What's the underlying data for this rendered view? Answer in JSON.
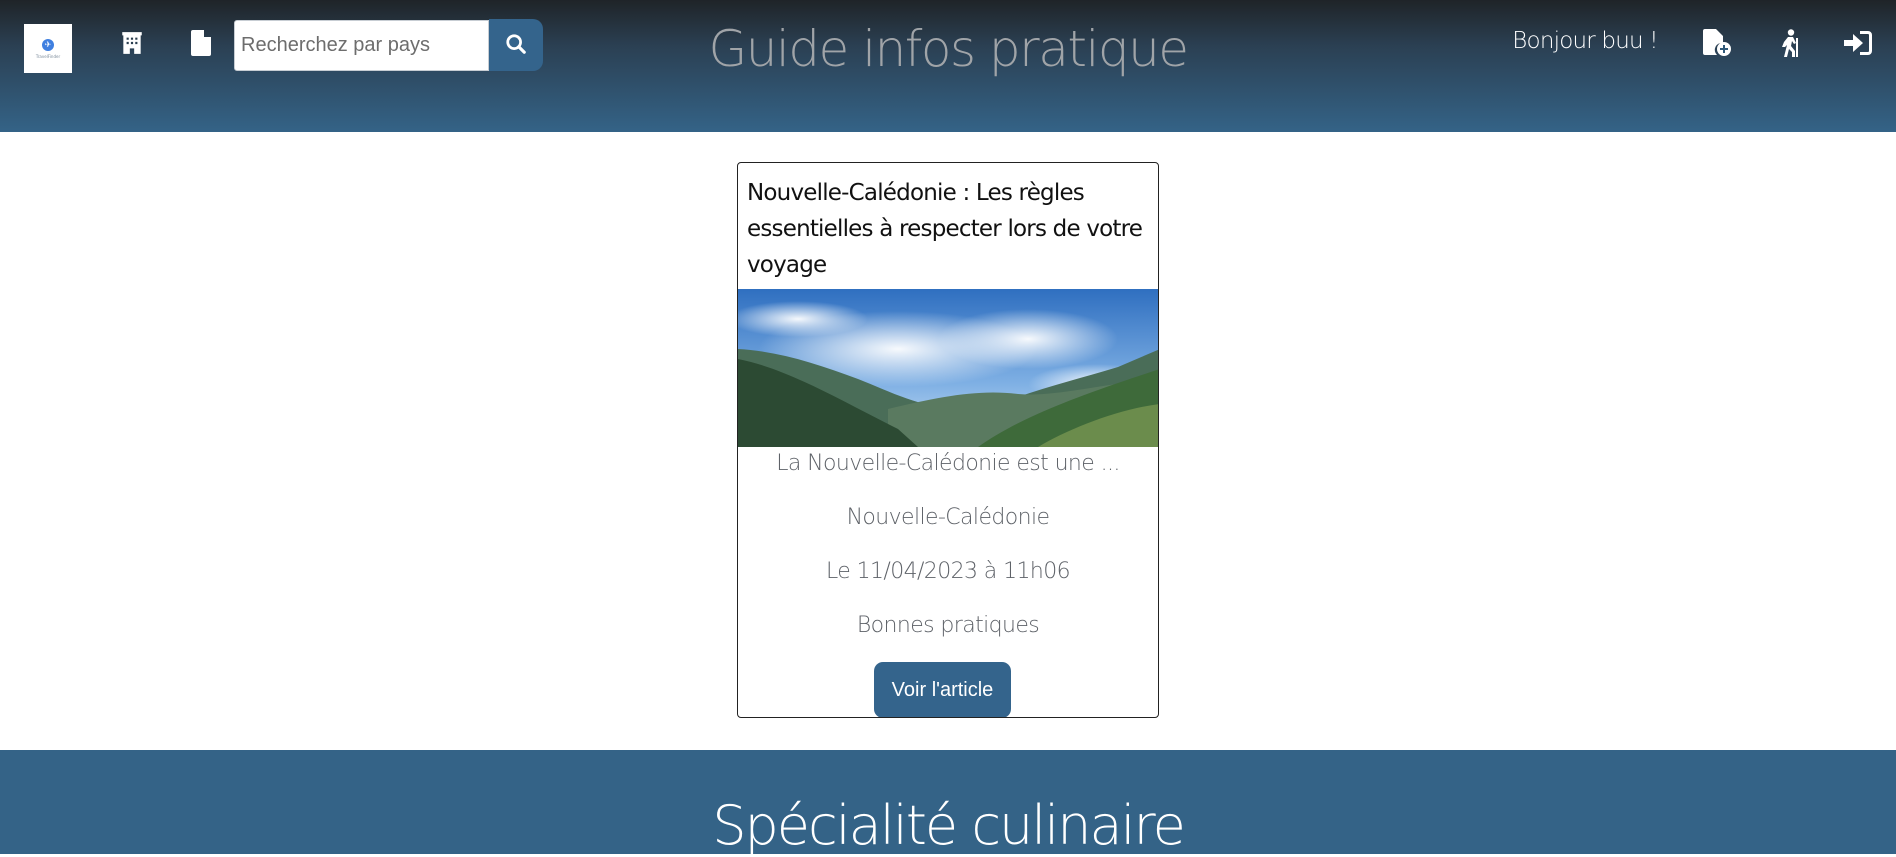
{
  "header": {
    "logo_text": "TravelFinder",
    "search": {
      "placeholder": "Recherchez par pays",
      "value": ""
    },
    "title": "Guide infos pratique",
    "greeting": "Bonjour buu !",
    "icons": [
      "building-icon",
      "document-icon",
      "search-icon",
      "file-add-icon",
      "hiker-icon",
      "sign-in-icon"
    ]
  },
  "article": {
    "title": "Nouvelle-Calédonie : Les règles essentielles à respecter lors de votre voyage",
    "excerpt": "La Nouvelle-Calédonie est une ...",
    "country": "Nouvelle-Calédonie",
    "date": "Le 11/04/2023 à 11h06",
    "category": "Bonnes pratiques",
    "button_label": "Voir l'article"
  },
  "section": {
    "title": "Spécialité culinaire"
  },
  "colors": {
    "primary": "#34648c",
    "header_top": "#1f2428",
    "text_muted": "#5e6268"
  }
}
